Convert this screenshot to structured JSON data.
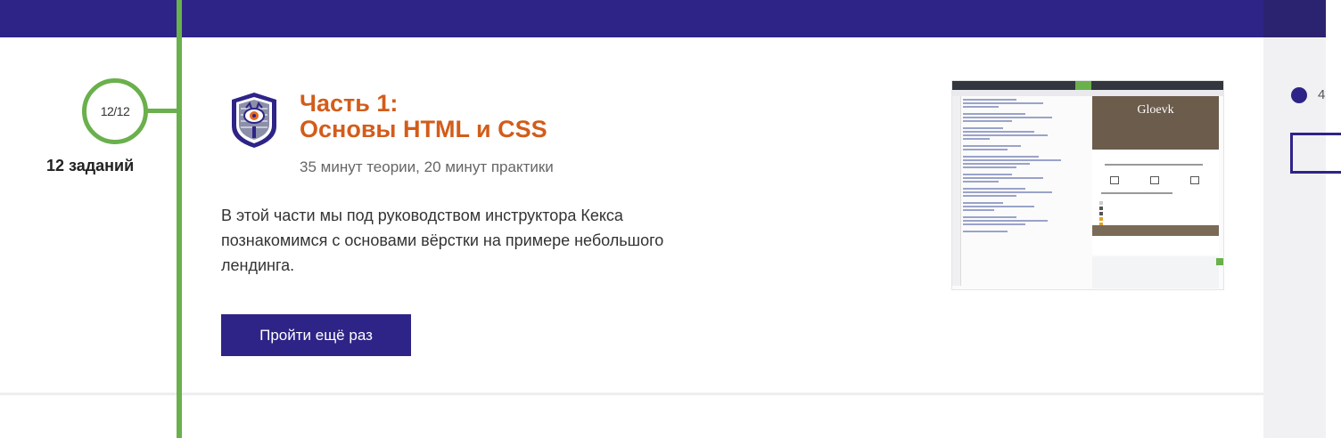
{
  "progress": {
    "label": "12/12",
    "tasks_label": "12 заданий"
  },
  "lesson": {
    "title_line1": "Часть 1:",
    "title_line2": "Основы HTML и CSS",
    "duration": "35 минут теории, 20 минут практики",
    "description": "В этой части мы под руководством инструктора Кекса познакомимся с основами вёрстки на примере небольшого лендинга.",
    "retry_button": "Пройти ещё раз"
  },
  "preview": {
    "site_title": "Gloevk"
  },
  "side": {
    "number": "4"
  },
  "colors": {
    "brand": "#2e2487",
    "accent": "#d35c1a",
    "success": "#6ab04c"
  },
  "icons": [
    "keks-badge-icon"
  ]
}
